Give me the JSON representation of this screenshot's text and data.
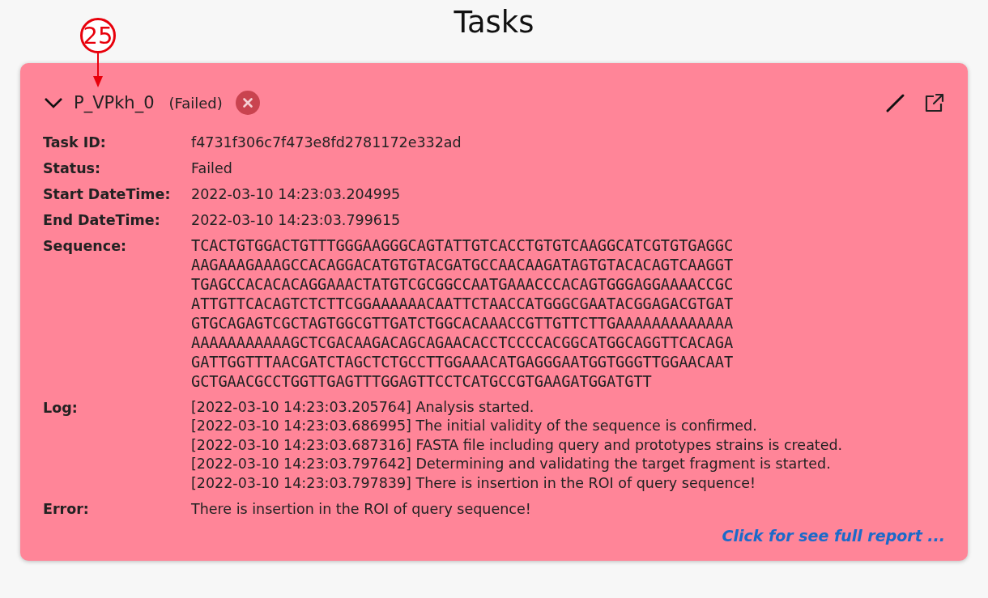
{
  "page_title": "Tasks",
  "annotation": {
    "label": "25"
  },
  "task": {
    "expanded": true,
    "name": "P_VPkh_0",
    "status": "(Failed)",
    "details": [
      {
        "kind": "text",
        "label": "Task ID:",
        "value": "f4731f306c7f473e8fd2781172e332ad"
      },
      {
        "kind": "text",
        "label": "Status:",
        "value": "Failed"
      },
      {
        "kind": "text",
        "label": "Start DateTime:",
        "value": "2022-03-10 14:23:03.204995"
      },
      {
        "kind": "text",
        "label": "End DateTime:",
        "value": "2022-03-10 14:23:03.799615"
      },
      {
        "kind": "sequence",
        "label": "Sequence:",
        "lines": [
          "TCACTGTGGACTGTTTGGGAAGGGCAGTATTGTCACCTGTGTCAAGGCATCGTGTGAGGC",
          "AAGAAAGAAAGCCACAGGACATGTGTACGATGCCAACAAGATAGTGTACACAGTCAAGGT",
          "TGAGCCACACACAGGAAACTATGTCGCGGCCAATGAAACCCACAGTGGGAGGAAAACCGC",
          "ATTGTTCACAGTCTCTTCGGAAAAAACAATTCTAACCATGGGCGAATACGGAGACGTGAT",
          "GTGCAGAGTCGCTAGTGGCGTTGATCTGGCACAAACCGTTGTTCTTGAAAAAAAAAAAAA",
          "AAAAAAAAAAAGCTCGACAAGACAGCAGAACACCTCCCCACGGCATGGCAGGTTCACAGA",
          "GATTGGTTTAACGATCTAGCTCTGCCTTGGAAACATGAGGGAATGGTGGGTTGGAACAAT",
          "GCTGAACGCCTGGTTGAGTTTGGAGTTCCTCATGCCGTGAAGATGGATGTT"
        ]
      },
      {
        "kind": "log",
        "label": "Log:",
        "lines": [
          "[2022-03-10 14:23:03.205764] Analysis started.",
          "[2022-03-10 14:23:03.686995] The initial validity of the sequence is confirmed.",
          "[2022-03-10 14:23:03.687316] FASTA file including query and prototypes strains is created.",
          "[2022-03-10 14:23:03.797642] Determining and validating the target fragment is started.",
          "[2022-03-10 14:23:03.797839] There is insertion in the ROI of query sequence!"
        ]
      },
      {
        "kind": "text",
        "label": "Error:",
        "value": "There is insertion in the ROI of query sequence!"
      }
    ],
    "report_link": "Click for see full report ..."
  }
}
